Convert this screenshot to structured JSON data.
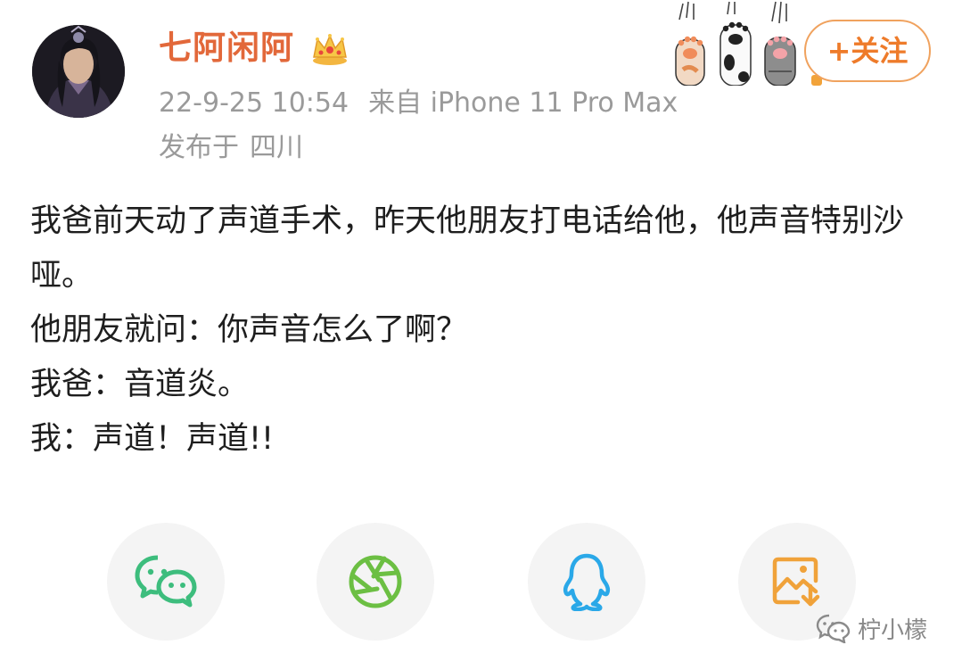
{
  "post": {
    "author": {
      "name": "七阿闲阿",
      "badge_icon": "crown-icon"
    },
    "meta": {
      "datetime": "22-9-25 10:54",
      "source": "来自 iPhone 11 Pro Max",
      "location_prefix": "发布于",
      "location": "四川"
    },
    "follow_label": "+关注",
    "body_lines": [
      "我爸前天动了声道手术，昨天他朋友打电话给他，他声音特别沙哑。",
      "他朋友就问：你声音怎么了啊？",
      "我爸：音道炎。",
      "我：声道！声道!!"
    ]
  },
  "share": {
    "buttons": [
      {
        "name": "wechat",
        "icon": "wechat-icon",
        "color": "#3dbd7d"
      },
      {
        "name": "moments",
        "icon": "moments-icon",
        "color": "#6cbf43"
      },
      {
        "name": "qq",
        "icon": "qq-icon",
        "color": "#2aa8e8"
      },
      {
        "name": "save-image",
        "icon": "save-image-icon",
        "color": "#f0a23a"
      }
    ]
  },
  "watermark": {
    "text": "柠小檬",
    "icon": "wechat-official-icon"
  },
  "colors": {
    "username": "#e2683a",
    "follow": "#ee7b2a",
    "meta": "#9a9a9a"
  }
}
